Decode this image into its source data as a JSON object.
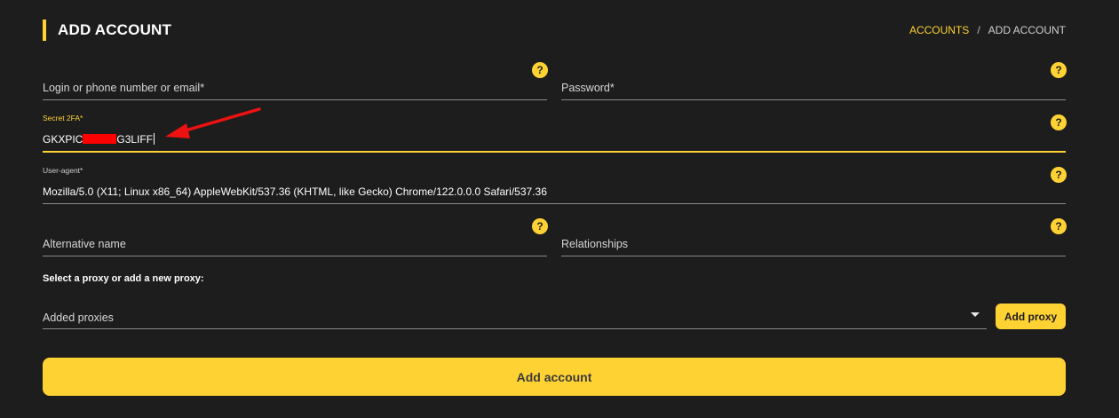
{
  "header": {
    "title": "ADD ACCOUNT",
    "breadcrumb": {
      "link": "ACCOUNTS",
      "separator": "/",
      "current": "ADD ACCOUNT"
    }
  },
  "form": {
    "login": {
      "label": "Login or phone number or email*",
      "help": "?"
    },
    "password": {
      "label": "Password*",
      "help": "?"
    },
    "secret_2fa": {
      "label": "Secret 2FA*",
      "value_prefix": "GKXPIC",
      "value_suffix": "G3LIFF",
      "help": "?"
    },
    "user_agent": {
      "label": "User-agent*",
      "value": "Mozilla/5.0 (X11; Linux x86_64) AppleWebKit/537.36 (KHTML, like Gecko) Chrome/122.0.0.0 Safari/537.36",
      "help": "?"
    },
    "alternative_name": {
      "label": "Alternative name",
      "help": "?"
    },
    "relationships": {
      "label": "Relationships",
      "help": "?"
    }
  },
  "proxy": {
    "heading": "Select a proxy or add a new proxy:",
    "select_placeholder": "Added proxies",
    "add_button": "Add proxy"
  },
  "submit_button": "Add account",
  "colors": {
    "accent": "#ffd234",
    "background": "#1d1d1d",
    "redaction": "#ff0000",
    "annotation_arrow": "#ee1111"
  }
}
